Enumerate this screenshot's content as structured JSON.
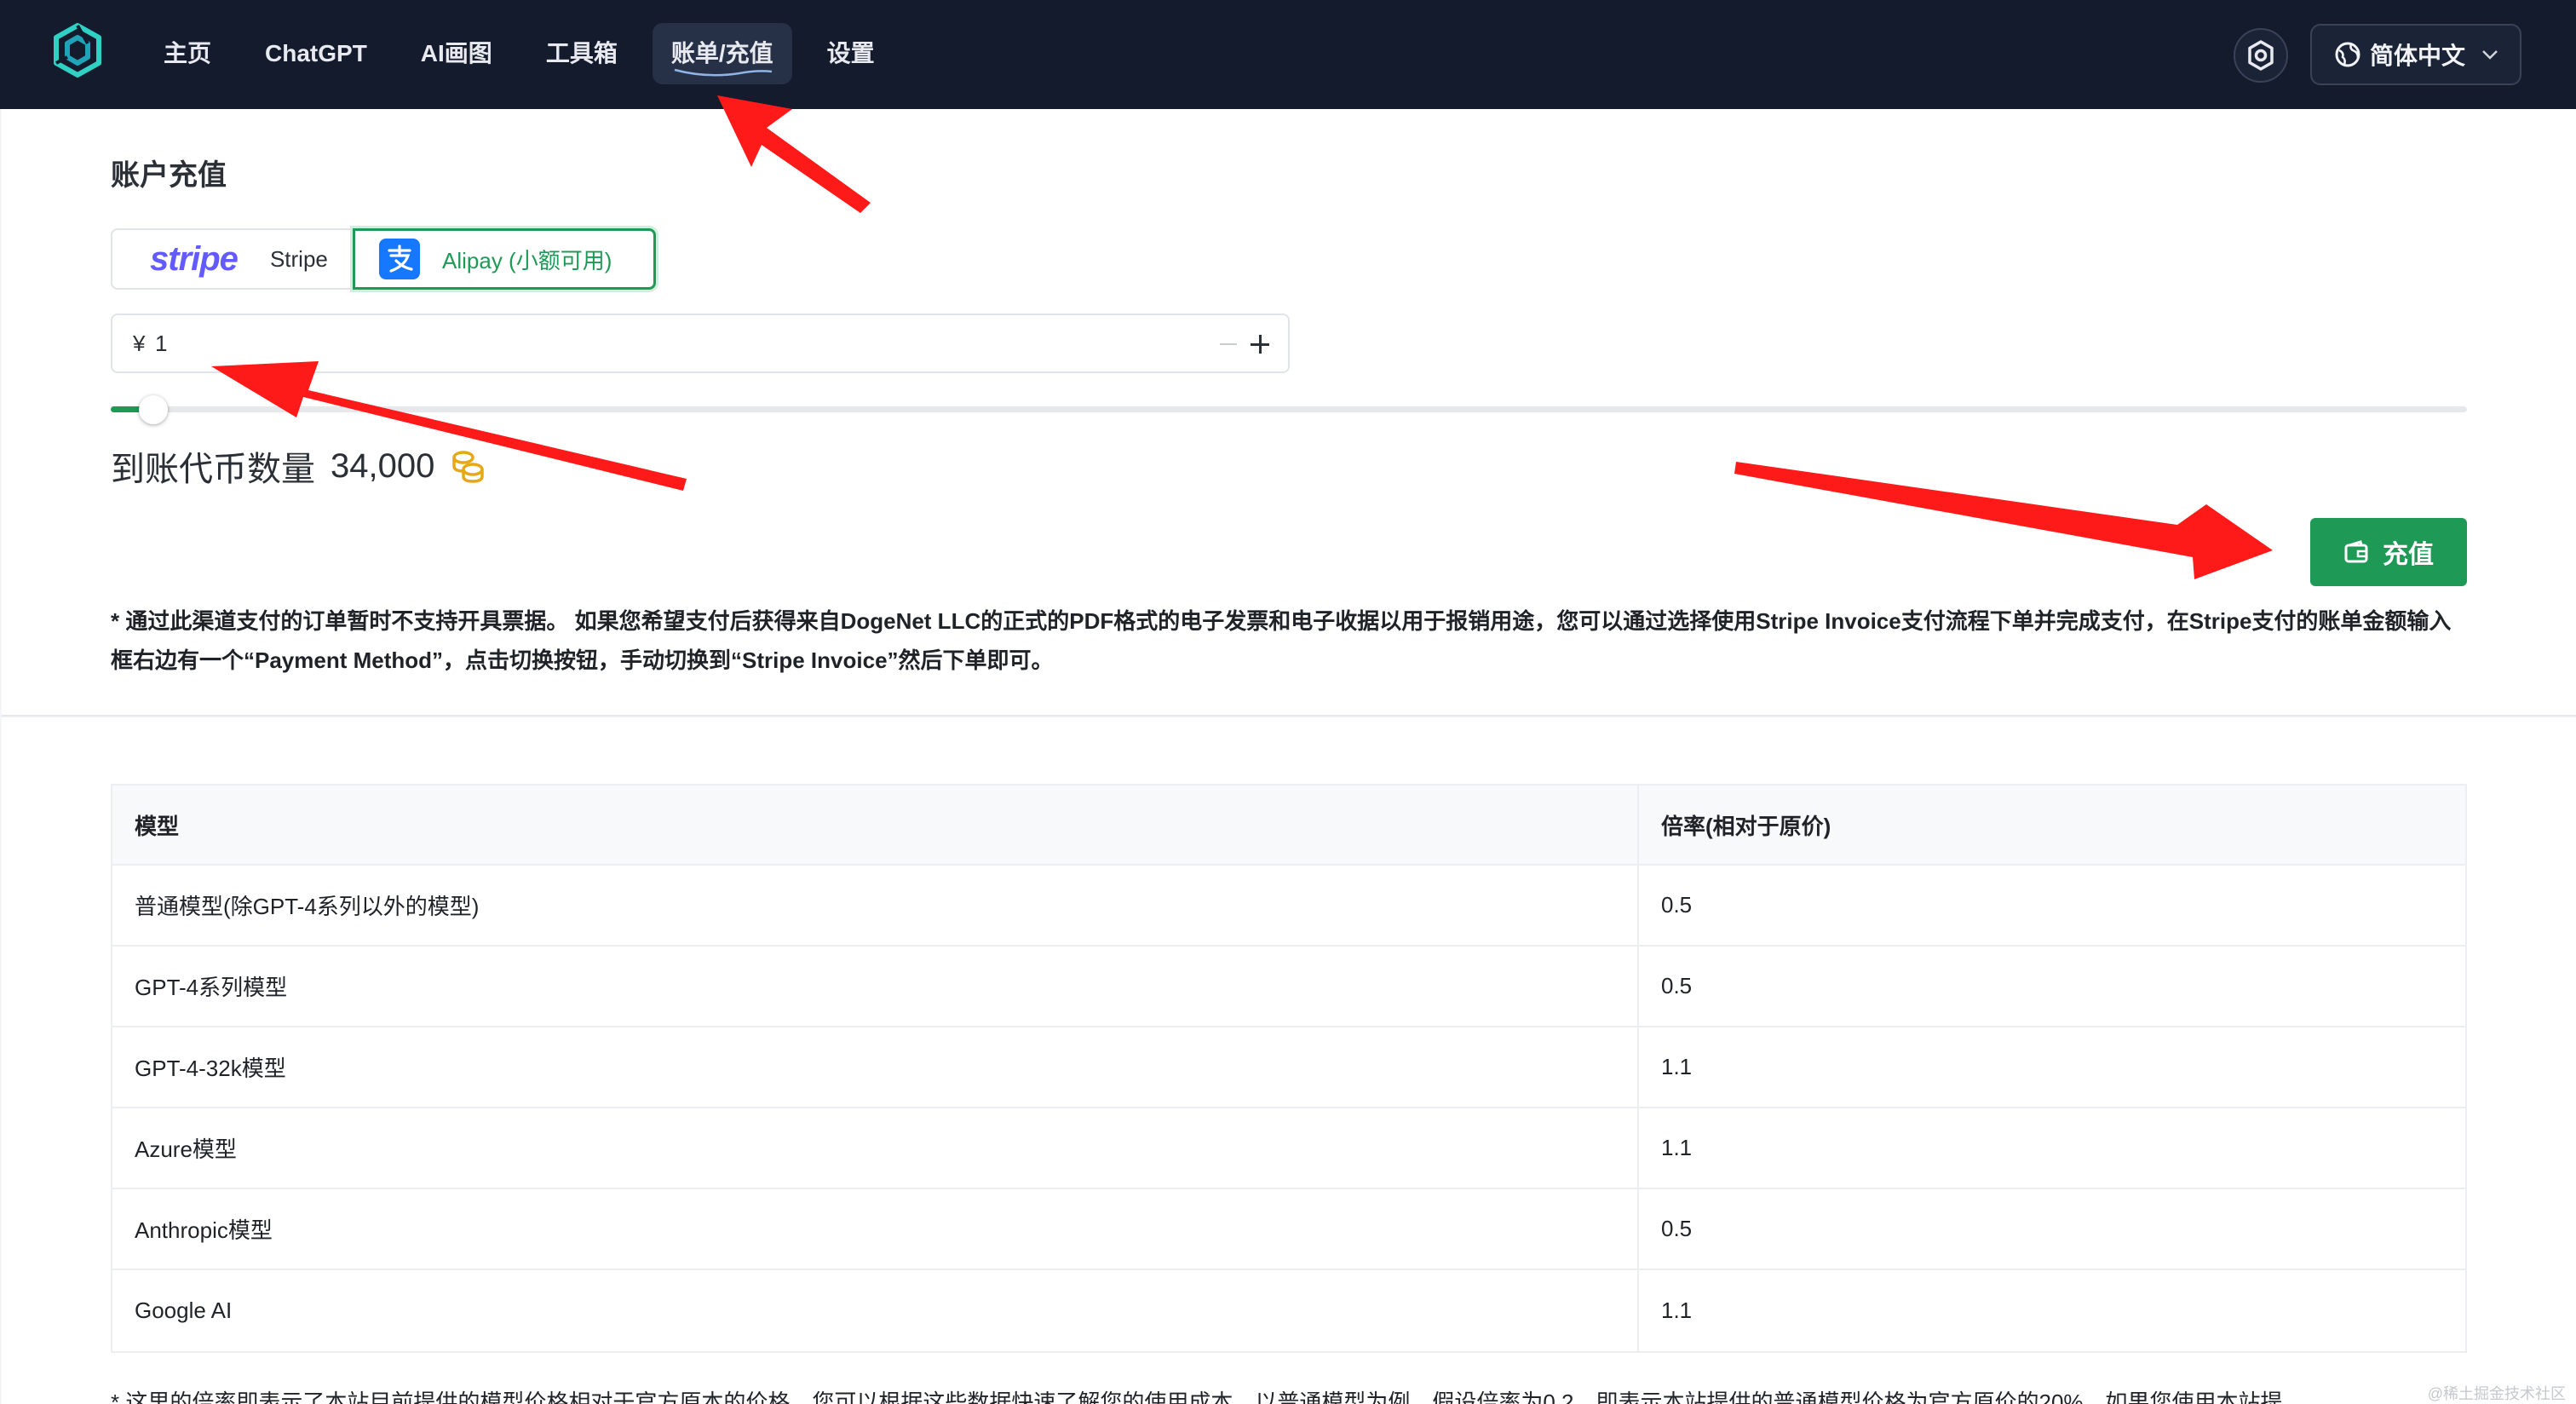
{
  "header": {
    "logo": "hexagon-logo",
    "nav": [
      {
        "label": "主页",
        "active": false
      },
      {
        "label": "ChatGPT",
        "active": false
      },
      {
        "label": "AI画图",
        "active": false
      },
      {
        "label": "工具箱",
        "active": false
      },
      {
        "label": "账单/充值",
        "active": true
      },
      {
        "label": "设置",
        "active": false
      }
    ],
    "settings_icon": "gear-icon",
    "language": "简体中文"
  },
  "recharge": {
    "title": "账户充值",
    "payment_methods": [
      {
        "logo_text": "stripe",
        "label": "Stripe",
        "selected": false
      },
      {
        "label": "Alipay (小额可用)",
        "selected": true
      }
    ],
    "amount_prefix": "¥",
    "amount_value": "1",
    "slider_fraction": 0.008,
    "tokens_label": "到账代币数量",
    "tokens_value": "34,000",
    "button_label": "充值",
    "note": "* 通过此渠道支付的订单暂时不支持开具票据。 如果您希望支付后获得来自DogeNet LLC的正式的PDF格式的电子发票和电子收据以用于报销用途，您可以通过选择使用Stripe Invoice支付流程下单并完成支付，在Stripe支付的账单金额输入框右边有一个“Payment Method”，点击切换按钮，手动切换到“Stripe Invoice”然后下单即可。"
  },
  "rates": {
    "headers": [
      "模型",
      "倍率(相对于原价)"
    ],
    "rows": [
      [
        "普通模型(除GPT-4系列以外的模型)",
        "0.5"
      ],
      [
        "GPT-4系列模型",
        "0.5"
      ],
      [
        "GPT-4-32k模型",
        "1.1"
      ],
      [
        "Azure模型",
        "1.1"
      ],
      [
        "Anthropic模型",
        "0.5"
      ],
      [
        "Google AI",
        "1.1"
      ]
    ],
    "note": "* 这里的倍率即表示了本站目前提供的模型价格相对于官方原本的价格，您可以根据这些数据快速了解您的使用成本，以普通模型为例，假设倍率为0.2，即表示本站提供的普通模型价格为官方原价的20%，如果您使用本站提"
  },
  "watermark": "@稀土掘金技术社区",
  "colors": {
    "header_bg": "#141b2d",
    "accent_green": "#1f9a56",
    "stripe_purple": "#635bff",
    "alipay_blue": "#1677ff",
    "coin_gold": "#e6a817",
    "arrow_red": "#ff1a1a"
  }
}
